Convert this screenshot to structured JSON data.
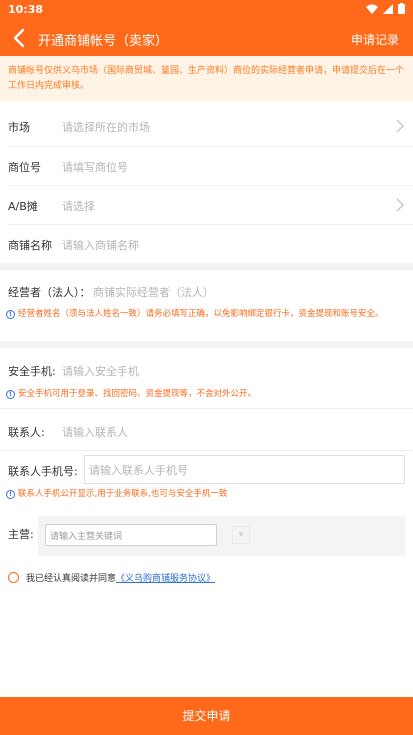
{
  "status_bar": {
    "time": "10:38"
  },
  "header": {
    "title": "开通商铺帐号（卖家）",
    "record_link": "申请记录"
  },
  "notice": "商铺帐号仅供义乌市场（国际商贸城、篁园、生产资料）商位的实际经营者申请，申请提交后在一个工作日内完成审核。",
  "form": {
    "market": {
      "label": "市场",
      "placeholder": "请选择所在的市场"
    },
    "stall_no": {
      "label": "商位号",
      "placeholder": "请填写商位号"
    },
    "ab_stall": {
      "label": "A/B摊",
      "placeholder": "请选择"
    },
    "shop_name": {
      "label": "商铺名称",
      "placeholder": "请输入商铺名称"
    },
    "operator": {
      "label": "经营者（法人）：",
      "placeholder": "商铺实际经营者（法人）"
    },
    "operator_hint": "经营者姓名（须与法人姓名一致）请务必填写正确，以免影响绑定银行卡，资金提现和账号安全。",
    "secure_phone": {
      "label": "安全手机:",
      "placeholder": "请输入安全手机"
    },
    "secure_phone_hint": "安全手机可用于登录、找回密码、资金提现等，不会对外公开。",
    "contact": {
      "label": "联系人:",
      "placeholder": "请输入联系人"
    },
    "contact_phone": {
      "label": "联系人手机号:",
      "placeholder": "请输入联系人手机号"
    },
    "contact_phone_hint": "联系人手机公开显示,用于业务联系,也可与安全手机一致",
    "manager": {
      "label": "主营:",
      "placeholder": "请输入主营关键词"
    }
  },
  "agreement": {
    "text": "我已经认真阅读并同意",
    "link": "《义乌购商铺服务协议》"
  },
  "submit_label": "提交申请",
  "colors": {
    "accent": "#ff6a1a",
    "link": "#2f6fd6"
  }
}
